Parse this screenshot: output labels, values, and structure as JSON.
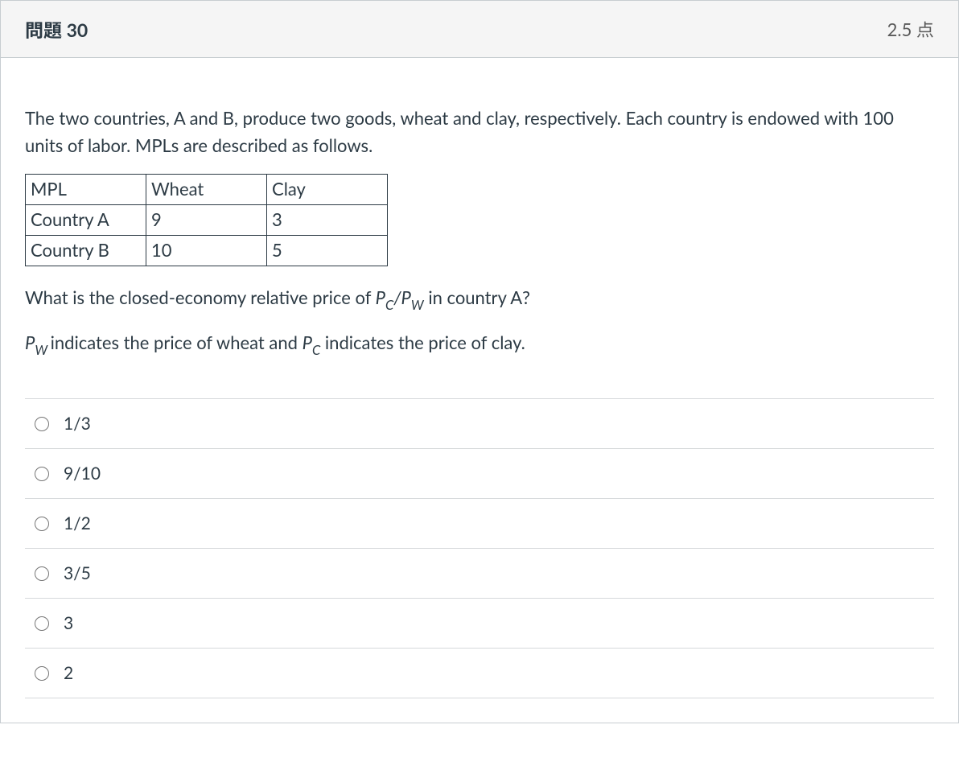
{
  "header": {
    "title": "問題 30",
    "points": "2.5 点"
  },
  "body": {
    "intro": "The two countries, A and B, produce two goods, wheat and clay, respectively. Each country is endowed with 100 units of labor. MPLs are described as follows.",
    "table": {
      "h_mpl": "MPL",
      "h_wheat": "Wheat",
      "h_clay": "Clay",
      "rowA_label": "Country A",
      "rowA_wheat": "9",
      "rowA_clay": "3",
      "rowB_label": "Country B",
      "rowB_wheat": "10",
      "rowB_clay": "5"
    },
    "q_line1_a": "What is the closed-economy relative price of ",
    "q_line1_p1": "P",
    "q_line1_s1": "C",
    "q_line1_slash": "/",
    "q_line1_p2": "P",
    "q_line1_s2": "W",
    "q_line1_b": " in country A?",
    "q_line2_p1": "P",
    "q_line2_s1": "W ",
    "q_line2_a": "indicates the price of wheat and ",
    "q_line2_p2": "P",
    "q_line2_s2": "C",
    "q_line2_b": " indicates the price of clay."
  },
  "options": {
    "o1": "1/3",
    "o2": "9/10",
    "o3": "1/2",
    "o4": "3/5",
    "o5": "3",
    "o6": "2"
  }
}
